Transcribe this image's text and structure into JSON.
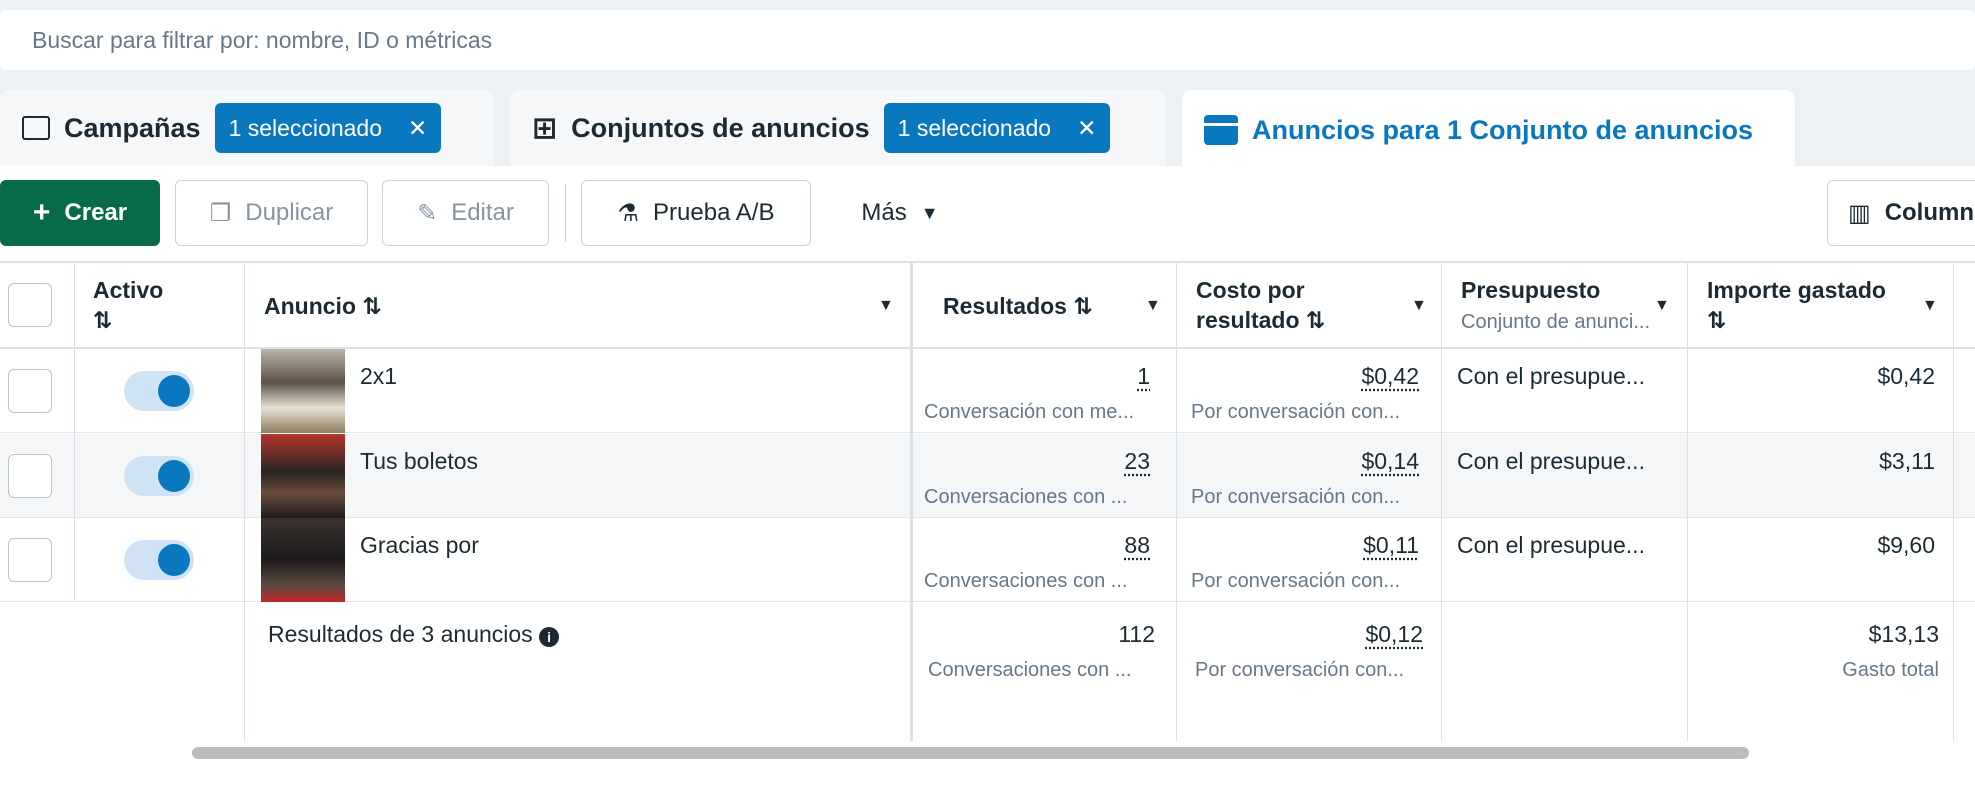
{
  "search": {
    "placeholder": "Buscar para filtrar por: nombre, ID o métricas"
  },
  "tabs": [
    {
      "label": "Campañas",
      "chip": "1 seleccionado",
      "icon": "folder-icon"
    },
    {
      "label": "Conjuntos de anuncios",
      "chip": "1 seleccionado",
      "icon": "grid-icon"
    },
    {
      "label": "Anuncios para 1 Conjunto de anuncios",
      "icon": "ad-icon",
      "active": true
    }
  ],
  "toolbar": {
    "crear": "Crear",
    "duplicar": "Duplicar",
    "editar": "Editar",
    "prueba": "Prueba A/B",
    "mas": "Más",
    "columnas": "Column"
  },
  "table": {
    "headers": {
      "activo": "Activo",
      "anuncio": "Anuncio",
      "resultados": "Resultados",
      "costo": "Costo por",
      "costo2": "resultado",
      "presupuesto": "Presupuesto",
      "presupuesto_sub": "Conjunto de anunci...",
      "importe": "Importe gastado"
    },
    "rows": [
      {
        "name": "2x1",
        "active": true,
        "resultados": "1",
        "resultados_sub": "Conversación con me...",
        "costo": "$0,42",
        "costo_sub": "Por conversación con...",
        "presupuesto": "Con el presupue...",
        "importe": "$0,42"
      },
      {
        "name": "Tus boletos",
        "active": true,
        "resultados": "23",
        "resultados_sub": "Conversaciones con ...",
        "costo": "$0,14",
        "costo_sub": "Por conversación con...",
        "presupuesto": "Con el presupue...",
        "importe": "$3,11"
      },
      {
        "name": "Gracias por",
        "active": true,
        "resultados": "88",
        "resultados_sub": "Conversaciones con ...",
        "costo": "$0,11",
        "costo_sub": "Por conversación con...",
        "presupuesto": "Con el presupue...",
        "importe": "$9,60"
      }
    ],
    "summary": {
      "label": "Resultados de 3 anuncios",
      "resultados": "112",
      "resultados_sub": "Conversaciones con ...",
      "costo": "$0,12",
      "costo_sub": "Por conversación con...",
      "importe": "$13,13",
      "importe_sub": "Gasto total"
    }
  },
  "colors": {
    "accent": "#0a78be",
    "create": "#076b47"
  }
}
